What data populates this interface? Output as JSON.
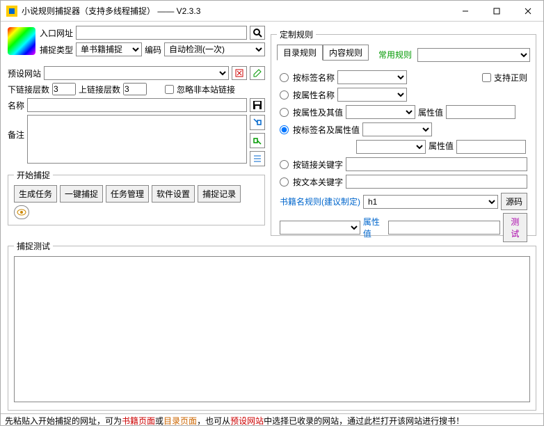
{
  "window": {
    "title": "小说规则捕捉器（支持多线程捕捉）  ——  V2.3.3"
  },
  "left": {
    "url_label": "入口网址",
    "url_value": "",
    "capture_type_label": "捕捉类型",
    "capture_type_value": "单书籍捕捉",
    "encode_label": "编码",
    "encode_value": "自动检测(一次)",
    "preset_label": "预设网站",
    "down_layers_label": "下链接层数",
    "down_layers_value": "3",
    "up_layers_label": "上链接层数",
    "up_layers_value": "3",
    "ignore_label": "忽略非本站链接",
    "name_label": "名称",
    "remark_label": "备注",
    "start_capture_legend": "开始捕捉",
    "btn_gen_task": "生成任务",
    "btn_one_click": "一键捕捉",
    "btn_task_mgmt": "任务管理",
    "btn_soft_set": "软件设置",
    "btn_capture_log": "捕捉记录"
  },
  "right": {
    "legend": "定制规则",
    "tab_catalog": "目录规则",
    "tab_content": "内容规则",
    "common_rule_label": "常用规则",
    "r_tagname": "按标签名称",
    "regex_label": "支持正则",
    "r_attrname": "按属性名称",
    "r_attrval": "按属性及其值",
    "attrval_label": "属性值",
    "r_tag_attrval": "按标签名及属性值",
    "r_linkkw": "按链接关键字",
    "r_textkw": "按文本关键字",
    "bookname_label": "书籍名规则(建议制定)",
    "bookname_value": "h1",
    "btn_source": "源码",
    "btn_test": "测试"
  },
  "test": {
    "legend": "捕捉测试"
  },
  "footer": {
    "p1": "先粘贴入开始捕捉的网址，可为",
    "p2": "书籍页面",
    "p3": "或",
    "p4": "目录页面",
    "p5": "，也可从",
    "p6": "预设网站",
    "p7": "中选择已收录的网站，通过此栏打开该网站进行搜书！"
  }
}
